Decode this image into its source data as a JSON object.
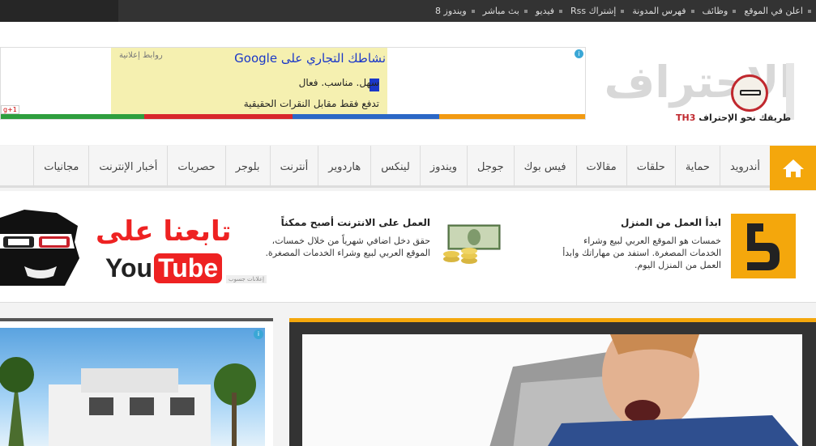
{
  "topnav": [
    "ويندوز 8",
    "بث مباشر",
    "فيديو",
    "إشتراك Rss",
    "فهرس المدونة",
    "وظائف",
    "اعلن في الموقع"
  ],
  "ad": {
    "label": "روابط إعلانية",
    "headline": "نشاطك التجاري على Google",
    "line1": "سهل. مناسب. فعال",
    "line2": "تدفع فقط مقابل النقرات الحقيقية",
    "gplus": "g+1",
    "info": "i"
  },
  "logo": {
    "text": "الاحتراف",
    "badge": "TH3",
    "tagline": "طريقك نحو الإحتراف"
  },
  "mainnav": [
    "أندرويد",
    "حماية",
    "حلقات",
    "مقالات",
    "فيس بوك",
    "جوجل",
    "ويندوز",
    "لينكس",
    "هاردوير",
    "أنترنت",
    "بلوجر",
    "حصريات",
    "أخبار الإنترنت",
    "مجانيات"
  ],
  "banner": {
    "b1_title": "ابدأ العمل من المنزل",
    "b1_text": "خمسات هو الموقع العربي لبيع وشراء الخدمات المصغرة. استفد من مهاراتك وابدأ العمل من المنزل اليوم.",
    "b2_title": "العمل على الانترنت أصبح ممكناً",
    "b2_text": "حقق دخل اضافي شهرياً من خلال خمسات، الموقع العربي لبيع وشراء الخدمات المصغرة.",
    "adsby": "إعلانات جسوب",
    "follow": "تابعنا على",
    "yt_you": "You",
    "yt_tube": "Tube"
  },
  "colors": {
    "accent": "#f4a70c",
    "topbar": "#333333",
    "youtube_red": "#e22222"
  }
}
